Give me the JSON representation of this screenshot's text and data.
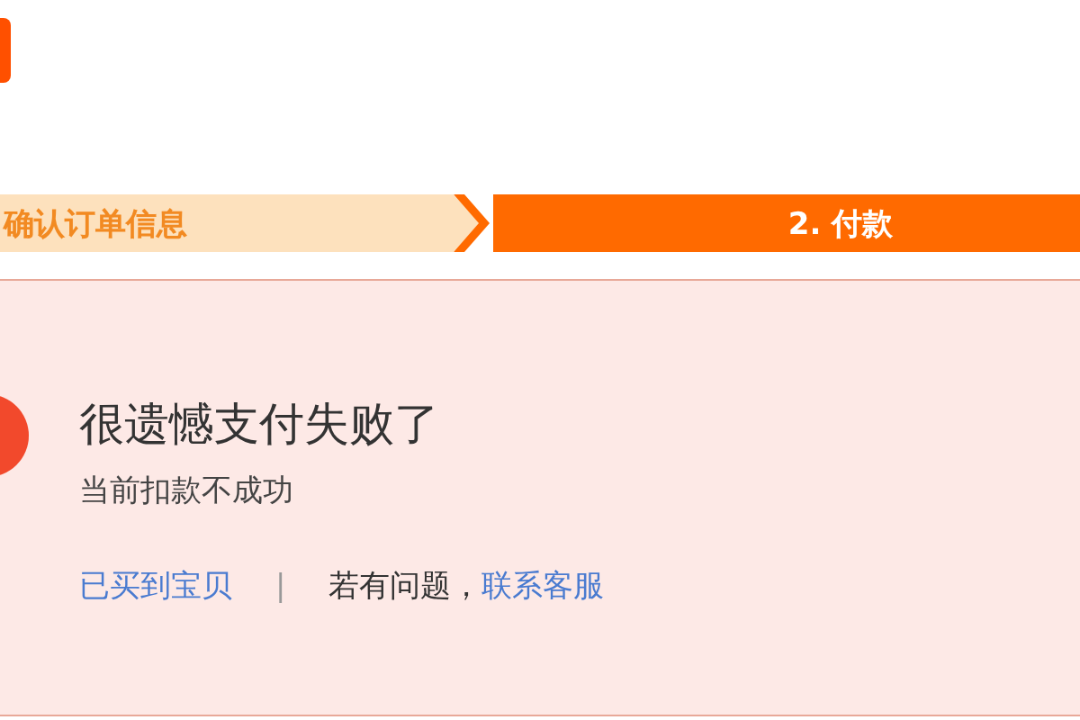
{
  "steps": [
    {
      "label": "确认订单信息",
      "selected": false
    },
    {
      "label": "2. 付款",
      "selected": true
    }
  ],
  "result": {
    "title": "很遗憾支付失败了",
    "message": "当前扣款不成功",
    "links": [
      {
        "kind": "link",
        "text": "已买到宝贝"
      },
      {
        "kind": "separator",
        "text": "|"
      },
      {
        "kind": "text",
        "text": "若有问题，"
      },
      {
        "kind": "link",
        "text": "联系客服"
      }
    ]
  }
}
